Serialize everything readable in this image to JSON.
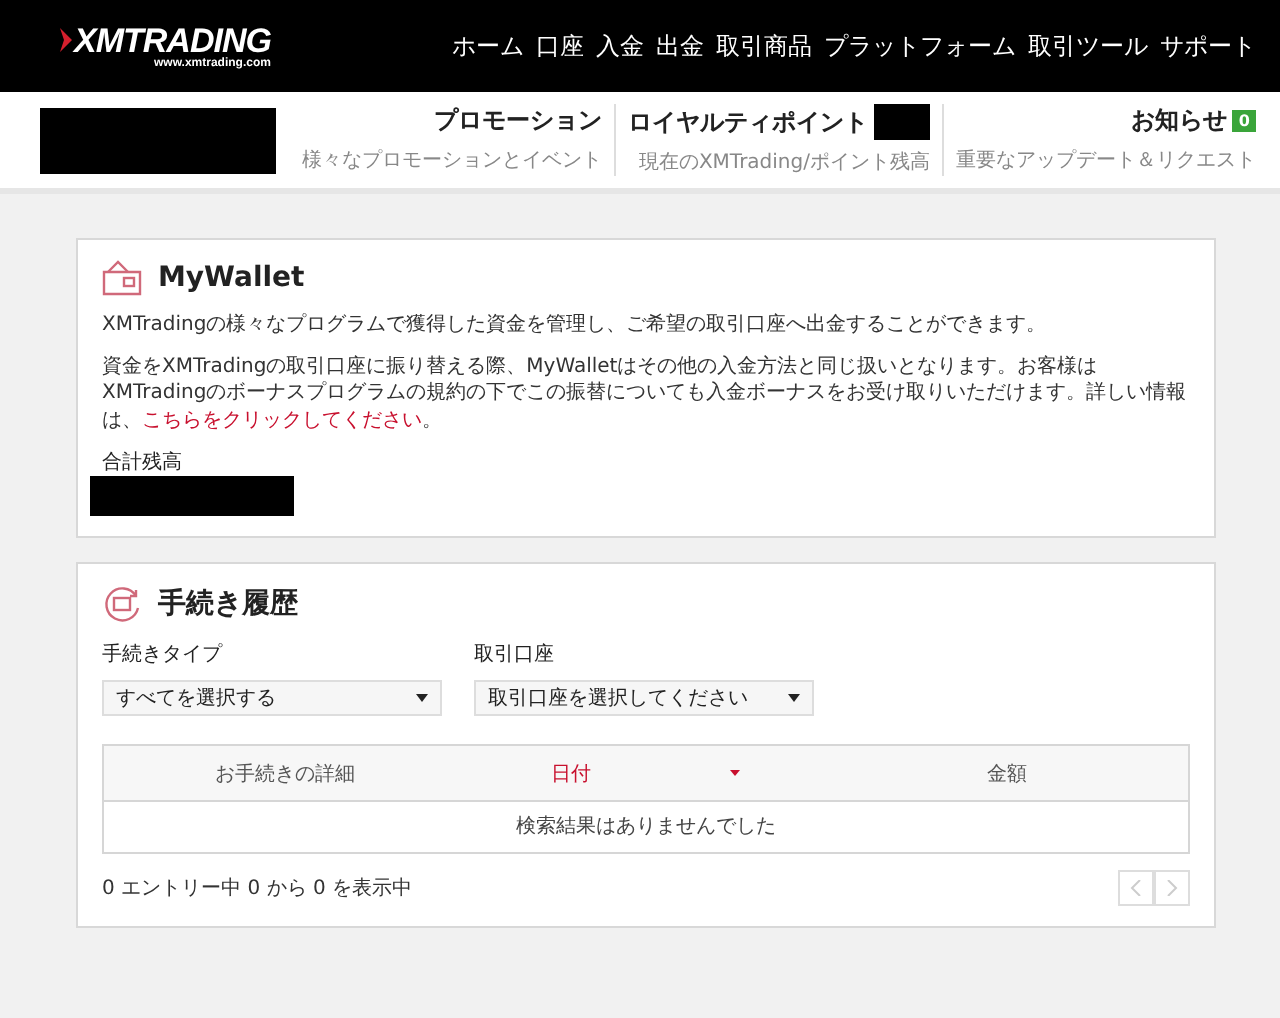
{
  "header": {
    "logo": "XMTRADING",
    "url": "www.xmtrading.com",
    "nav": [
      "ホーム",
      "口座",
      "入金",
      "出金",
      "取引商品",
      "プラットフォーム",
      "取引ツール",
      "サポート"
    ]
  },
  "subheader": [
    {
      "title": "プロモーション",
      "subtitle": "様々なプロモーションとイベント"
    },
    {
      "title": "ロイヤルティポイント",
      "subtitle": "現在のXMTrading/ポイント残高"
    },
    {
      "title": "お知らせ",
      "subtitle": "重要なアップデート＆リクエスト",
      "badge": "0"
    }
  ],
  "wallet": {
    "title": "MyWallet",
    "intro": "XMTradingの様々なプログラムで獲得した資金を管理し、ご希望の取引口座へ出金することができます。",
    "note": {
      "text": "資金をXMTradingの取引口座に振り替える際、MyWalletはその他の入金方法と同じ扱いとなります。お客様はXMTradingのボーナスプログラムの規約の下でこの振替についても入金ボーナスをお受け取りいただけます。詳しい情報は、",
      "link": "こちらをクリックしてください",
      "tail": "。"
    },
    "balance_label": "合計残高"
  },
  "history": {
    "title": "手続き履歴",
    "filters": [
      {
        "label": "手続きタイプ",
        "value": "すべてを選択する"
      },
      {
        "label": "取引口座",
        "value": "取引口座を選択してください"
      }
    ],
    "columns": [
      {
        "label": "お手続きの詳細",
        "sorted": false
      },
      {
        "label": "日付",
        "sorted": true
      },
      {
        "label": "金額",
        "sorted": false
      }
    ],
    "empty_message": "検索結果はありませんでした",
    "info": "0 エントリー中 0 から 0 を表示中"
  }
}
